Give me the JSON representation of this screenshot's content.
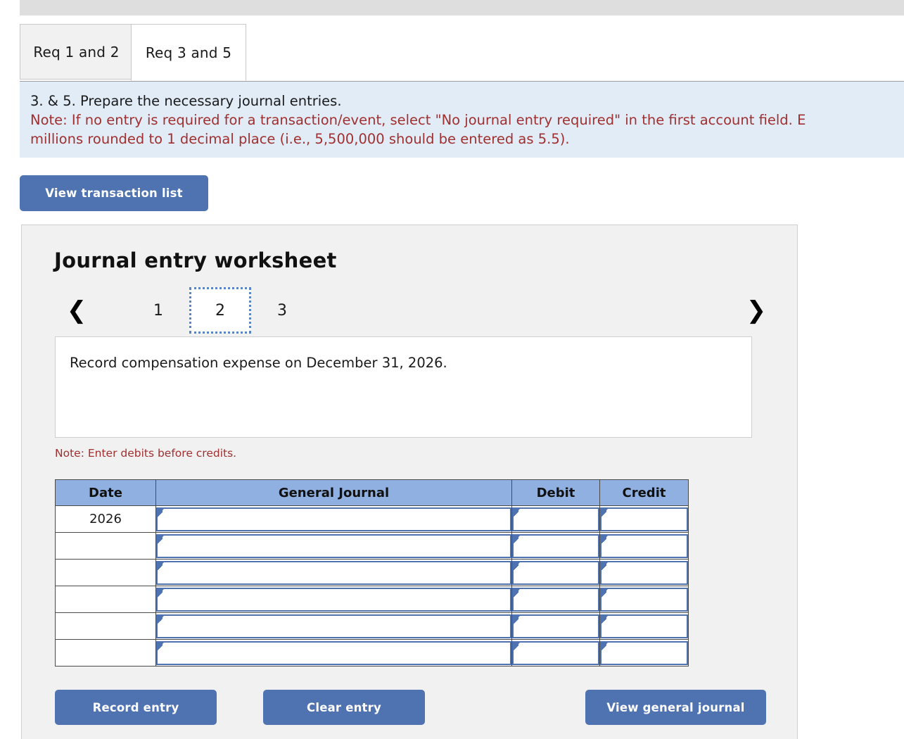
{
  "tabs": [
    {
      "label": "Req 1 and 2",
      "active": false
    },
    {
      "label": "Req 3 and 5",
      "active": true
    }
  ],
  "instructions": {
    "line1": "3. & 5. Prepare the necessary journal entries.",
    "line2": "Note: If no entry is required for a transaction/event, select \"No journal entry required\" in the first account field. E",
    "line3": "millions rounded to 1 decimal place (i.e., 5,500,000 should be entered as 5.5)."
  },
  "toolbar": {
    "view_transaction_list_label": "View transaction list"
  },
  "worksheet": {
    "title": "Journal entry worksheet",
    "pager": {
      "prev_icon": "chevron-left-icon",
      "next_icon": "chevron-right-icon",
      "pages": [
        "1",
        "2",
        "3"
      ],
      "active_page": "2"
    },
    "transaction_text": "Record compensation expense on December 31, 2026.",
    "debit_note": "Note: Enter debits before credits.",
    "table": {
      "headers": [
        "Date",
        "General Journal",
        "Debit",
        "Credit"
      ],
      "rows": [
        {
          "date": "2026",
          "journal": "",
          "debit": "",
          "credit": ""
        },
        {
          "date": "",
          "journal": "",
          "debit": "",
          "credit": ""
        },
        {
          "date": "",
          "journal": "",
          "debit": "",
          "credit": ""
        },
        {
          "date": "",
          "journal": "",
          "debit": "",
          "credit": ""
        },
        {
          "date": "",
          "journal": "",
          "debit": "",
          "credit": ""
        },
        {
          "date": "",
          "journal": "",
          "debit": "",
          "credit": ""
        }
      ]
    },
    "buttons": {
      "record_entry": "Record entry",
      "clear_entry": "Clear entry",
      "view_general_journal": "View general journal"
    }
  },
  "colors": {
    "accent_blue": "#4f72b0",
    "header_blue": "#8fb0e0",
    "instruction_bg": "#e1ecf7",
    "note_red": "#a03030",
    "panel_gray": "#f1f1f1"
  }
}
